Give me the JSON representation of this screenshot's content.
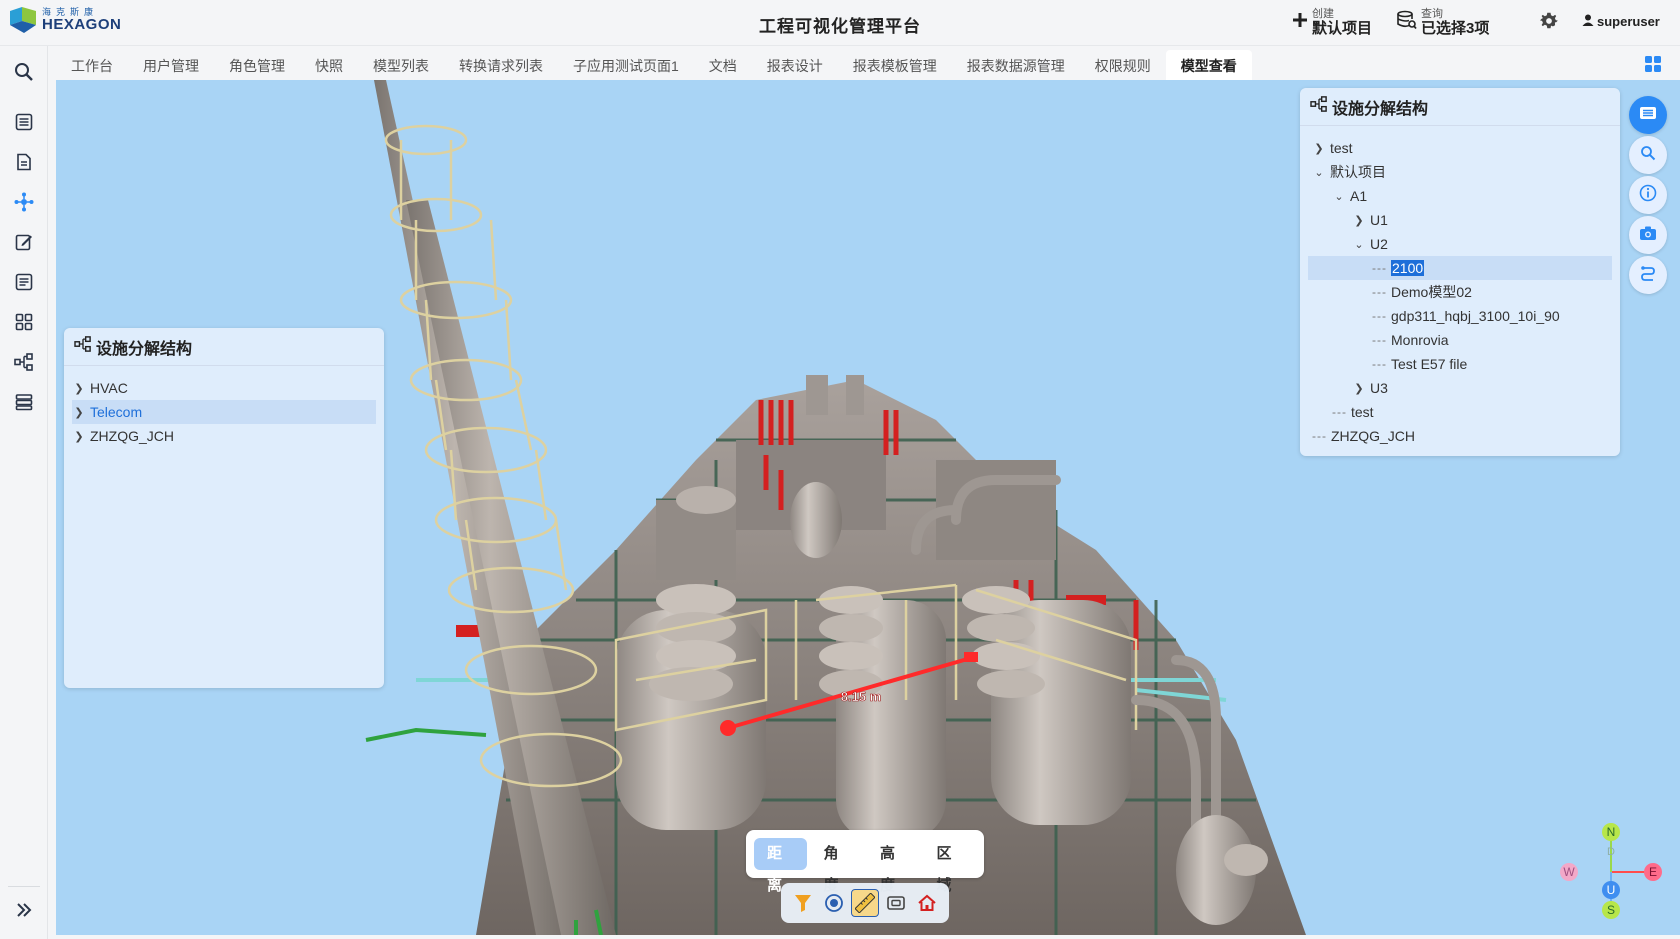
{
  "header": {
    "logo_cn": "海克斯康",
    "logo_en": "HEXAGON",
    "title": "工程可视化管理平台",
    "create_small": "创建",
    "create_big": "默认项目",
    "query_small": "查询",
    "query_big": "已选择3项",
    "username": "superuser"
  },
  "tabs": [
    {
      "label": "工作台"
    },
    {
      "label": "用户管理"
    },
    {
      "label": "角色管理"
    },
    {
      "label": "快照"
    },
    {
      "label": "模型列表"
    },
    {
      "label": "转换请求列表"
    },
    {
      "label": "子应用测试页面1"
    },
    {
      "label": "文档"
    },
    {
      "label": "报表设计"
    },
    {
      "label": "报表模板管理"
    },
    {
      "label": "报表数据源管理"
    },
    {
      "label": "权限规则"
    },
    {
      "label": "模型查看"
    }
  ],
  "left_panel": {
    "title": "设施分解结构",
    "items": [
      "HVAC",
      "Telecom",
      "ZHZQG_JCH"
    ],
    "selected": "Telecom"
  },
  "right_panel": {
    "title": "设施分解结构",
    "rows": [
      "test",
      "默认项目",
      "A1",
      "U1",
      "U2",
      "2100",
      "Demo模型02",
      "gdp311_hqbj_3100_10i_90",
      "Monrovia",
      "Test E57 file",
      "U3",
      "test",
      "ZHZQG_JCH"
    ],
    "selected": "2100"
  },
  "measure": {
    "distance_label": "8.15 m",
    "modes": [
      "距离",
      "角度",
      "高度",
      "区域"
    ],
    "active_mode": "距离"
  },
  "compass": {
    "n": "N",
    "d": "D",
    "e": "E",
    "w": "W",
    "u": "U",
    "s": "S"
  },
  "colors": {
    "accent": "#2b8af5",
    "sky": "#a9d4f5",
    "panel_bg": "#e1eefc",
    "selection": "#1e6fd9",
    "measure_line": "#ff2a2a"
  }
}
